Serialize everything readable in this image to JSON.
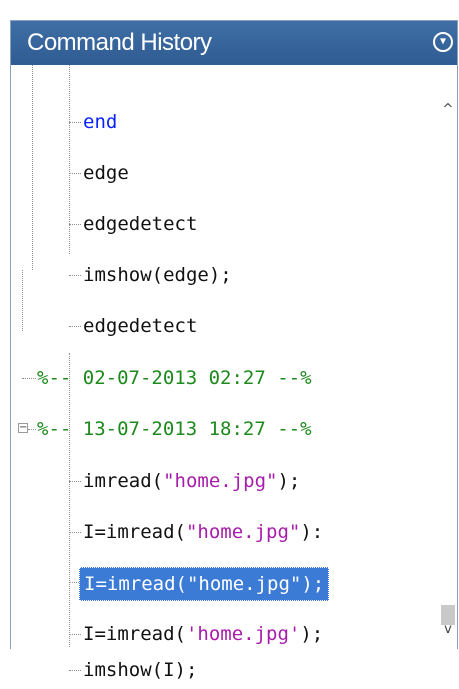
{
  "panel": {
    "title": "Command History",
    "menu_icon": "circle-chevron-down-icon"
  },
  "history": [
    {
      "text": "end",
      "style": "keyword"
    },
    {
      "text": "edge",
      "style": "plain"
    },
    {
      "text": "edgedetect",
      "style": "plain"
    },
    {
      "text": "imshow(edge);",
      "style": "plain"
    },
    {
      "text": "edgedetect",
      "style": "plain"
    },
    {
      "text": "%-- 02-07-2013 02:27 --%",
      "style": "session"
    },
    {
      "text": "%-- 13-07-2013 18:27 --%",
      "style": "session",
      "expander": "−"
    },
    {
      "pre": "imread(",
      "str": "\"home.jpg\"",
      "post": ");"
    },
    {
      "pre": "I=imread(",
      "str": "\"home.jpg\"",
      "post": "):"
    },
    {
      "pre": "I=imread(",
      "str": "\"home.jpg\"",
      "post": ");",
      "selected": true
    },
    {
      "pre": "I=imread(",
      "str": "'home.jpg'",
      "post": ");"
    },
    {
      "text": "imshow(I);",
      "style": "plain"
    }
  ],
  "colors": {
    "titlebar": "#3467a1",
    "keyword": "#0a21ff",
    "session": "#1d8a1d",
    "string": "#a81cab",
    "selection": "#3b7bd6"
  },
  "scrollbar": {
    "up_icon": "chevron-up-icon",
    "down_icon": "chevron-down-icon",
    "up_glyph": "^",
    "down_glyph": "v"
  }
}
